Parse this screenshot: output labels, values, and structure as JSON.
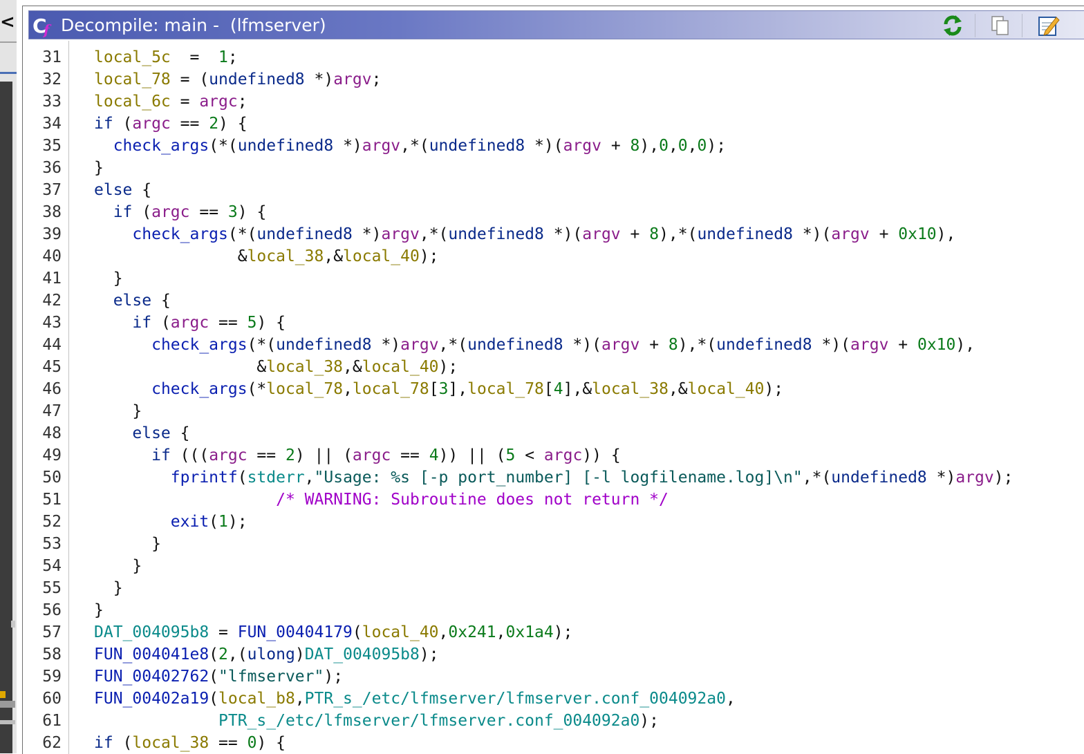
{
  "window": {
    "title": "Decompile: main -  (lfmserver)",
    "left_panel_glyph": "<"
  },
  "toolbar": {
    "buttons": [
      {
        "name": "refresh-icon"
      },
      {
        "name": "copy-icon"
      },
      {
        "name": "edit-icon"
      }
    ]
  },
  "colors": {
    "keyword": "#0a2a8a",
    "function": "#0a1fb0",
    "local": "#8a7a00",
    "param": "#8a1d8a",
    "number": "#0a7a1a",
    "global": "#0a8a8a",
    "string": "#0a5a5a",
    "comment": "#a000c8",
    "title_bar_start": "#4a5ab0"
  },
  "code": {
    "lines": [
      {
        "num": "31",
        "tokens": [
          [
            "v",
            "local_5c"
          ],
          [
            "",
            "  =  "
          ],
          [
            "n",
            "1"
          ],
          [
            "",
            ";"
          ]
        ]
      },
      {
        "num": "32",
        "tokens": [
          [
            "v",
            "local_78"
          ],
          [
            "",
            " = ("
          ],
          [
            "k",
            "undefined8"
          ],
          [
            "",
            " *)"
          ],
          [
            "p",
            "argv"
          ],
          [
            "",
            ";"
          ]
        ]
      },
      {
        "num": "33",
        "tokens": [
          [
            "v",
            "local_6c"
          ],
          [
            "",
            " = "
          ],
          [
            "p",
            "argc"
          ],
          [
            "",
            ";"
          ]
        ]
      },
      {
        "num": "34",
        "tokens": [
          [
            "k",
            "if"
          ],
          [
            "",
            " ("
          ],
          [
            "p",
            "argc"
          ],
          [
            "",
            " == "
          ],
          [
            "n",
            "2"
          ],
          [
            "",
            ") {"
          ]
        ]
      },
      {
        "num": "35",
        "tokens": [
          [
            "",
            "  "
          ],
          [
            "fn",
            "check_args"
          ],
          [
            "",
            "(*("
          ],
          [
            "k",
            "undefined8"
          ],
          [
            "",
            " *)"
          ],
          [
            "p",
            "argv"
          ],
          [
            "",
            ",*("
          ],
          [
            "k",
            "undefined8"
          ],
          [
            "",
            " *)("
          ],
          [
            "p",
            "argv"
          ],
          [
            "",
            " + "
          ],
          [
            "n",
            "8"
          ],
          [
            "",
            "),"
          ],
          [
            "n",
            "0"
          ],
          [
            "",
            ","
          ],
          [
            "n",
            "0"
          ],
          [
            "",
            ","
          ],
          [
            "n",
            "0"
          ],
          [
            "",
            ");"
          ]
        ]
      },
      {
        "num": "36",
        "tokens": [
          [
            "",
            "}"
          ]
        ]
      },
      {
        "num": "37",
        "tokens": [
          [
            "k",
            "else"
          ],
          [
            "",
            " {"
          ]
        ]
      },
      {
        "num": "38",
        "tokens": [
          [
            "",
            "  "
          ],
          [
            "k",
            "if"
          ],
          [
            "",
            " ("
          ],
          [
            "p",
            "argc"
          ],
          [
            "",
            " == "
          ],
          [
            "n",
            "3"
          ],
          [
            "",
            ") {"
          ]
        ]
      },
      {
        "num": "39",
        "tokens": [
          [
            "",
            "    "
          ],
          [
            "fn",
            "check_args"
          ],
          [
            "",
            "(*("
          ],
          [
            "k",
            "undefined8"
          ],
          [
            "",
            " *)"
          ],
          [
            "p",
            "argv"
          ],
          [
            "",
            ",*("
          ],
          [
            "k",
            "undefined8"
          ],
          [
            "",
            " *)("
          ],
          [
            "p",
            "argv"
          ],
          [
            "",
            " + "
          ],
          [
            "n",
            "8"
          ],
          [
            "",
            "),*("
          ],
          [
            "k",
            "undefined8"
          ],
          [
            "",
            " *)("
          ],
          [
            "p",
            "argv"
          ],
          [
            "",
            " + "
          ],
          [
            "n",
            "0x10"
          ],
          [
            "",
            "),"
          ]
        ]
      },
      {
        "num": "40",
        "tokens": [
          [
            "",
            "               &"
          ],
          [
            "v",
            "local_38"
          ],
          [
            "",
            ",&"
          ],
          [
            "v",
            "local_40"
          ],
          [
            "",
            ");"
          ]
        ]
      },
      {
        "num": "41",
        "tokens": [
          [
            "",
            "  }"
          ]
        ]
      },
      {
        "num": "42",
        "tokens": [
          [
            "",
            "  "
          ],
          [
            "k",
            "else"
          ],
          [
            "",
            " {"
          ]
        ]
      },
      {
        "num": "43",
        "tokens": [
          [
            "",
            "    "
          ],
          [
            "k",
            "if"
          ],
          [
            "",
            " ("
          ],
          [
            "p",
            "argc"
          ],
          [
            "",
            " == "
          ],
          [
            "n",
            "5"
          ],
          [
            "",
            ") {"
          ]
        ]
      },
      {
        "num": "44",
        "tokens": [
          [
            "",
            "      "
          ],
          [
            "fn",
            "check_args"
          ],
          [
            "",
            "(*("
          ],
          [
            "k",
            "undefined8"
          ],
          [
            "",
            " *)"
          ],
          [
            "p",
            "argv"
          ],
          [
            "",
            ",*("
          ],
          [
            "k",
            "undefined8"
          ],
          [
            "",
            " *)("
          ],
          [
            "p",
            "argv"
          ],
          [
            "",
            " + "
          ],
          [
            "n",
            "8"
          ],
          [
            "",
            "),*("
          ],
          [
            "k",
            "undefined8"
          ],
          [
            "",
            " *)("
          ],
          [
            "p",
            "argv"
          ],
          [
            "",
            " + "
          ],
          [
            "n",
            "0x10"
          ],
          [
            "",
            "),"
          ]
        ]
      },
      {
        "num": "45",
        "tokens": [
          [
            "",
            "                 &"
          ],
          [
            "v",
            "local_38"
          ],
          [
            "",
            ",&"
          ],
          [
            "v",
            "local_40"
          ],
          [
            "",
            ");"
          ]
        ]
      },
      {
        "num": "46",
        "tokens": [
          [
            "",
            "      "
          ],
          [
            "fn",
            "check_args"
          ],
          [
            "",
            "(*"
          ],
          [
            "v",
            "local_78"
          ],
          [
            "",
            ","
          ],
          [
            "v",
            "local_78"
          ],
          [
            "",
            "["
          ],
          [
            "n",
            "3"
          ],
          [
            "",
            "],"
          ],
          [
            "v",
            "local_78"
          ],
          [
            "",
            "["
          ],
          [
            "n",
            "4"
          ],
          [
            "",
            "],&"
          ],
          [
            "v",
            "local_38"
          ],
          [
            "",
            ",&"
          ],
          [
            "v",
            "local_40"
          ],
          [
            "",
            ");"
          ]
        ]
      },
      {
        "num": "47",
        "tokens": [
          [
            "",
            "    }"
          ]
        ]
      },
      {
        "num": "48",
        "tokens": [
          [
            "",
            "    "
          ],
          [
            "k",
            "else"
          ],
          [
            "",
            " {"
          ]
        ]
      },
      {
        "num": "49",
        "tokens": [
          [
            "",
            "      "
          ],
          [
            "k",
            "if"
          ],
          [
            "",
            " ((("
          ],
          [
            "p",
            "argc"
          ],
          [
            "",
            " == "
          ],
          [
            "n",
            "2"
          ],
          [
            "",
            ") || ("
          ],
          [
            "p",
            "argc"
          ],
          [
            "",
            " == "
          ],
          [
            "n",
            "4"
          ],
          [
            "",
            ")) || ("
          ],
          [
            "n",
            "5"
          ],
          [
            "",
            " < "
          ],
          [
            "p",
            "argc"
          ],
          [
            "",
            ")) {"
          ]
        ]
      },
      {
        "num": "50",
        "tokens": [
          [
            "",
            "        "
          ],
          [
            "fn",
            "fprintf"
          ],
          [
            "",
            "("
          ],
          [
            "g",
            "stderr"
          ],
          [
            "",
            ","
          ],
          [
            "s",
            "\"Usage: %s [-p port_number] [-l logfilename.log]\\n\""
          ],
          [
            "",
            ",*("
          ],
          [
            "k",
            "undefined8"
          ],
          [
            "",
            " *)"
          ],
          [
            "p",
            "argv"
          ],
          [
            "",
            ");"
          ]
        ]
      },
      {
        "num": "51",
        "tokens": [
          [
            "",
            "                   "
          ],
          [
            "c",
            "/* WARNING: Subroutine does not return */"
          ]
        ]
      },
      {
        "num": "52",
        "tokens": [
          [
            "",
            "        "
          ],
          [
            "fn",
            "exit"
          ],
          [
            "",
            "("
          ],
          [
            "n",
            "1"
          ],
          [
            "",
            ");"
          ]
        ]
      },
      {
        "num": "53",
        "tokens": [
          [
            "",
            "      }"
          ]
        ]
      },
      {
        "num": "54",
        "tokens": [
          [
            "",
            "    }"
          ]
        ]
      },
      {
        "num": "55",
        "tokens": [
          [
            "",
            "  }"
          ]
        ]
      },
      {
        "num": "56",
        "tokens": [
          [
            "",
            "}"
          ]
        ]
      },
      {
        "num": "57",
        "tokens": [
          [
            "g",
            "DAT_004095b8"
          ],
          [
            "",
            " = "
          ],
          [
            "fn",
            "FUN_00404179"
          ],
          [
            "",
            "("
          ],
          [
            "v",
            "local_40"
          ],
          [
            "",
            ","
          ],
          [
            "n",
            "0x241"
          ],
          [
            "",
            ","
          ],
          [
            "n",
            "0x1a4"
          ],
          [
            "",
            ");"
          ]
        ]
      },
      {
        "num": "58",
        "tokens": [
          [
            "fn",
            "FUN_004041e8"
          ],
          [
            "",
            "("
          ],
          [
            "n",
            "2"
          ],
          [
            "",
            ",("
          ],
          [
            "k",
            "ulong"
          ],
          [
            "",
            ")"
          ],
          [
            "g",
            "DAT_004095b8"
          ],
          [
            "",
            ");"
          ]
        ]
      },
      {
        "num": "59",
        "tokens": [
          [
            "fn",
            "FUN_00402762"
          ],
          [
            "",
            "("
          ],
          [
            "s",
            "\"lfmserver\""
          ],
          [
            "",
            ");"
          ]
        ]
      },
      {
        "num": "60",
        "tokens": [
          [
            "fn",
            "FUN_00402a19"
          ],
          [
            "",
            "("
          ],
          [
            "v",
            "local_b8"
          ],
          [
            "",
            ","
          ],
          [
            "g",
            "PTR_s_/etc/lfmserver/lfmserver.conf_004092a0"
          ],
          [
            "",
            ","
          ]
        ]
      },
      {
        "num": "61",
        "tokens": [
          [
            "",
            "             "
          ],
          [
            "g",
            "PTR_s_/etc/lfmserver/lfmserver.conf_004092a0"
          ],
          [
            "",
            ");"
          ]
        ]
      },
      {
        "num": "62",
        "tokens": [
          [
            "k",
            "if"
          ],
          [
            "",
            " ("
          ],
          [
            "v",
            "local_38"
          ],
          [
            "",
            " == "
          ],
          [
            "n",
            "0"
          ],
          [
            "",
            ") {"
          ]
        ]
      }
    ]
  }
}
